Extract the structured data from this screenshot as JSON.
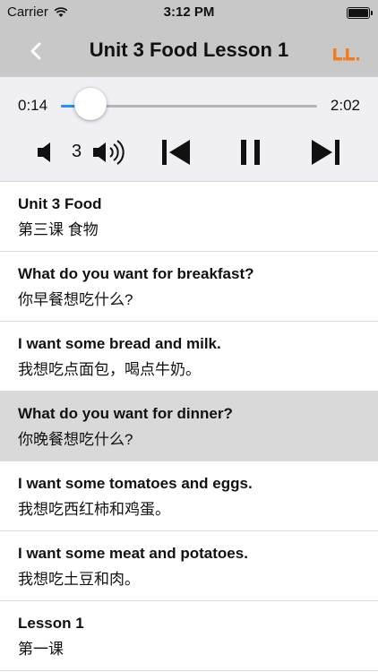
{
  "status": {
    "carrier": "Carrier",
    "time": "3:12 PM"
  },
  "nav": {
    "title": "Unit 3 Food Lesson 1",
    "back_icon": "chevron-left-icon",
    "logo_icon": "app-logo-icon",
    "logo_color": "#f47c20"
  },
  "player": {
    "current_time": "0:14",
    "total_time": "2:02",
    "progress": 0.115,
    "accent_color": "#1e90ff",
    "volume_level": "3",
    "icons": [
      "volume-down-icon",
      "volume-up-icon",
      "skip-previous-icon",
      "pause-icon",
      "skip-next-icon"
    ]
  },
  "lines": [
    {
      "en": "Unit 3 Food",
      "zh": "第三课 食物",
      "selected": false
    },
    {
      "en": "What do you want for breakfast?",
      "zh": "你早餐想吃什么?",
      "selected": false
    },
    {
      "en": "I want some bread and milk.",
      "zh": "我想吃点面包，喝点牛奶。",
      "selected": false
    },
    {
      "en": "What do you want for dinner?",
      "zh": "你晚餐想吃什么?",
      "selected": true
    },
    {
      "en": "I want some tomatoes and eggs.",
      "zh": "我想吃西红柿和鸡蛋。",
      "selected": false
    },
    {
      "en": "I want some meat and potatoes.",
      "zh": "我想吃土豆和肉。",
      "selected": false
    },
    {
      "en": "Lesson 1",
      "zh": "第一课",
      "selected": false
    }
  ]
}
